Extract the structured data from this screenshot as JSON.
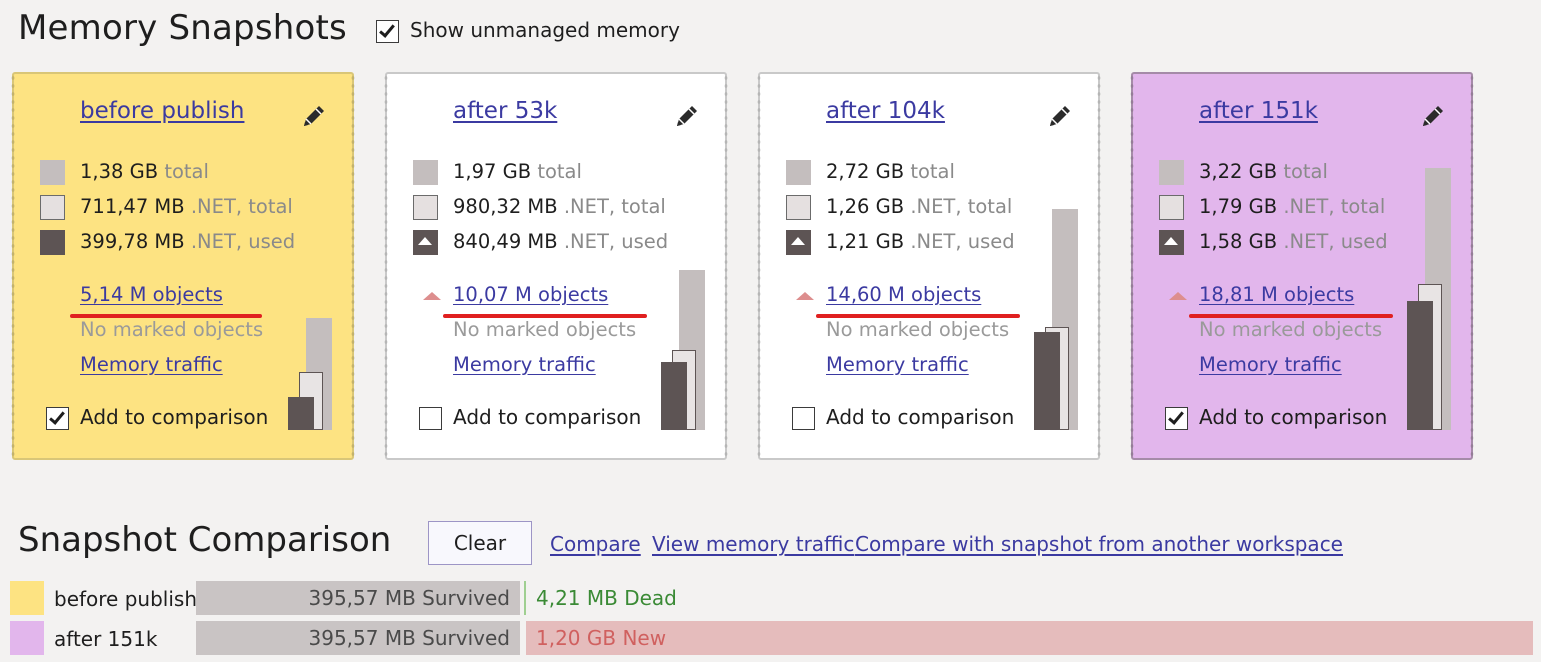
{
  "header": {
    "title": "Memory Snapshots",
    "show_unmanaged_label": "Show unmanaged memory",
    "show_unmanaged_checked": true
  },
  "snapshots": [
    {
      "title": "before publish",
      "color": "#fde382",
      "total": "1,38 GB",
      "total_suffix": "total",
      "net_total": "711,47 MB",
      "net_total_suffix": ".NET, total",
      "net_used": "399,78 MB",
      "net_used_suffix": ".NET, used",
      "objects": "5,14 M objects",
      "marked": "No marked objects",
      "traffic": "Memory traffic",
      "add_label": "Add to comparison",
      "add_checked": true,
      "growth_indicator": false,
      "bar_total_gb": 1.38,
      "bar_net_total_gb": 0.711,
      "bar_net_used_gb": 0.4
    },
    {
      "title": "after 53k",
      "color": "#ffffff",
      "total": "1,97 GB",
      "total_suffix": "total",
      "net_total": "980,32 MB",
      "net_total_suffix": ".NET, total",
      "net_used": "840,49 MB",
      "net_used_suffix": ".NET, used",
      "objects": "10,07 M objects",
      "marked": "No marked objects",
      "traffic": "Memory traffic",
      "add_label": "Add to comparison",
      "add_checked": false,
      "growth_indicator": true,
      "bar_total_gb": 1.97,
      "bar_net_total_gb": 0.98,
      "bar_net_used_gb": 0.84
    },
    {
      "title": "after 104k",
      "color": "#ffffff",
      "total": "2,72 GB",
      "total_suffix": "total",
      "net_total": "1,26 GB",
      "net_total_suffix": ".NET, total",
      "net_used": "1,21 GB",
      "net_used_suffix": ".NET, used",
      "objects": "14,60 M objects",
      "marked": "No marked objects",
      "traffic": "Memory traffic",
      "add_label": "Add to comparison",
      "add_checked": false,
      "growth_indicator": true,
      "bar_total_gb": 2.72,
      "bar_net_total_gb": 1.26,
      "bar_net_used_gb": 1.21
    },
    {
      "title": "after 151k",
      "color": "#e2b6ec",
      "total": "3,22 GB",
      "total_suffix": "total",
      "net_total": "1,79 GB",
      "net_total_suffix": ".NET, total",
      "net_used": "1,58 GB",
      "net_used_suffix": ".NET, used",
      "objects": "18,81 M objects",
      "marked": "No marked objects",
      "traffic": "Memory traffic",
      "add_label": "Add to comparison",
      "add_checked": true,
      "growth_indicator": true,
      "bar_total_gb": 3.22,
      "bar_net_total_gb": 1.79,
      "bar_net_used_gb": 1.58
    }
  ],
  "comparison": {
    "title": "Snapshot Comparison",
    "clear_label": "Clear",
    "compare_label": "Compare",
    "view_traffic_label": "View memory traffic",
    "compare_other_label": "Compare with snapshot from another workspace",
    "rows": [
      {
        "name": "before publish",
        "color": "#fde382",
        "survived": "395,57 MB Survived",
        "other": "4,21 MB Dead",
        "other_kind": "dead"
      },
      {
        "name": "after 151k",
        "color": "#e2b6ec",
        "survived": "395,57 MB Survived",
        "other": "1,20 GB New",
        "other_kind": "new"
      }
    ]
  }
}
